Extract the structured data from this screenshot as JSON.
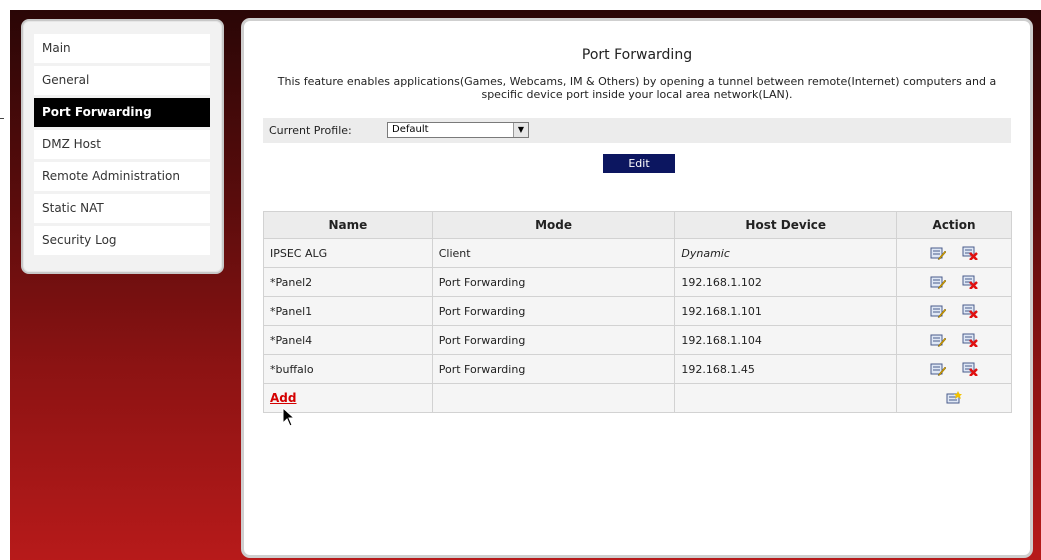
{
  "sidebar": {
    "items": [
      {
        "label": "Main",
        "active": false
      },
      {
        "label": "General",
        "active": false
      },
      {
        "label": "Port Forwarding",
        "active": true
      },
      {
        "label": "DMZ Host",
        "active": false
      },
      {
        "label": "Remote Administration",
        "active": false
      },
      {
        "label": "Static NAT",
        "active": false
      },
      {
        "label": "Security Log",
        "active": false
      }
    ]
  },
  "page": {
    "title": "Port Forwarding",
    "description": "This feature enables applications(Games, Webcams, IM & Others) by opening a tunnel between remote(Internet) computers and a specific device port inside your local area network(LAN)."
  },
  "profile": {
    "label": "Current Profile:",
    "selected": "Default"
  },
  "edit_button": "Edit",
  "table": {
    "headers": [
      "Name",
      "Mode",
      "Host Device",
      "Action"
    ],
    "rows": [
      {
        "name": "IPSEC ALG",
        "mode": "Client",
        "host": "Dynamic"
      },
      {
        "name": "*Panel2",
        "mode": "Port Forwarding",
        "host": "192.168.1.102"
      },
      {
        "name": "*Panel1",
        "mode": "Port Forwarding",
        "host": "192.168.1.101"
      },
      {
        "name": "*Panel4",
        "mode": "Port Forwarding",
        "host": "192.168.1.104"
      },
      {
        "name": "*buffalo",
        "mode": "Port Forwarding",
        "host": "192.168.1.45"
      }
    ],
    "add_label": "Add"
  },
  "icons": {
    "edit": "edit-icon",
    "delete": "delete-icon",
    "add": "add-icon",
    "cursor": "mouse-pointer-icon"
  },
  "colors": {
    "active_menu_bg": "#000000",
    "edit_button_bg": "#0c1660",
    "add_link": "#d40000",
    "background_gradient_top": "#2a0606",
    "background_gradient_bottom": "#b71a1a"
  }
}
